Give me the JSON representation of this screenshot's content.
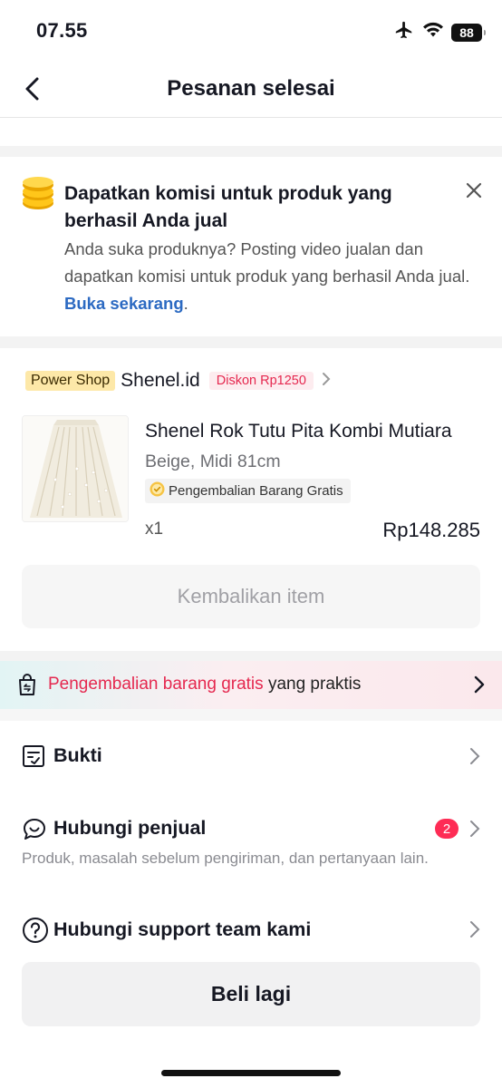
{
  "status": {
    "time": "07.55",
    "battery": "88"
  },
  "header": {
    "title": "Pesanan selesai"
  },
  "promo": {
    "title": "Dapatkan komisi untuk produk yang berhasil Anda jual",
    "body": "Anda suka produknya? Posting video jualan dan dapatkan komisi untuk produk yang berhasil Anda jual. ",
    "link": "Buka sekarang",
    "link_suffix": "."
  },
  "order": {
    "shop_badge": "Power Shop",
    "shop_name": "Shenel.id",
    "discount": "Diskon Rp1250",
    "product_title": "Shenel Rok Tutu Pita Kombi Mutiara",
    "variant": "Beige, Midi 81cm",
    "return_badge": "Pengembalian Barang Gratis",
    "quantity": "x1",
    "price": "Rp148.285",
    "return_button": "Kembalikan item"
  },
  "banner": {
    "highlight": "Pengembalian barang gratis",
    "rest": " yang praktis"
  },
  "menu": {
    "proof": "Bukti",
    "contact_seller": "Hubungi penjual",
    "contact_seller_badge": "2",
    "contact_seller_sub": "Produk, masalah sebelum pengiriman, dan pertanyaan lain.",
    "support": "Hubungi support team kami"
  },
  "footer": {
    "buy_again": "Beli lagi"
  },
  "colors": {
    "accent_red": "#fe2c55",
    "link_blue": "#2c6ac2",
    "badge_gold": "#fde8a8"
  }
}
